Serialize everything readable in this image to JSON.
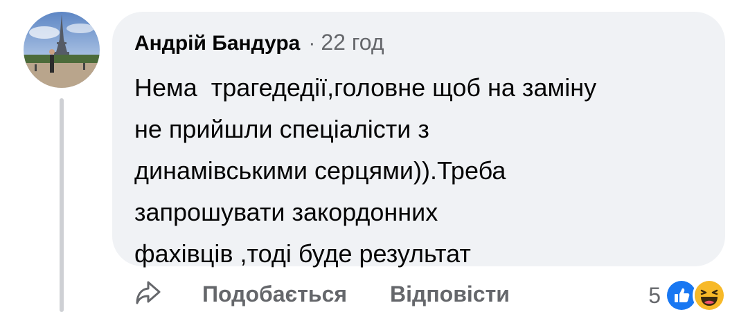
{
  "comment": {
    "author": "Андрій Бандура",
    "separator": "·",
    "timestamp": "22 год",
    "text_lines": [
      "Нема  трагедедії,головне щоб на заміну",
      "не прийшли спеціалісти з",
      "динамівськими серцями)).Треба",
      "запрошувати закордонних",
      "фахівців ,тоді буде результат"
    ]
  },
  "actions": {
    "like_label": "Подобається",
    "reply_label": "Відповісти",
    "share_icon": "share-icon"
  },
  "reactions": {
    "count": "5",
    "types": [
      "like",
      "haha"
    ],
    "colors": {
      "like": "#1877f2",
      "haha": "#f7b928"
    }
  },
  "colors": {
    "bubble_bg": "#f0f2f5",
    "secondary_text": "#65676b",
    "primary_text": "#050505",
    "thread_line": "#ced0d4"
  }
}
